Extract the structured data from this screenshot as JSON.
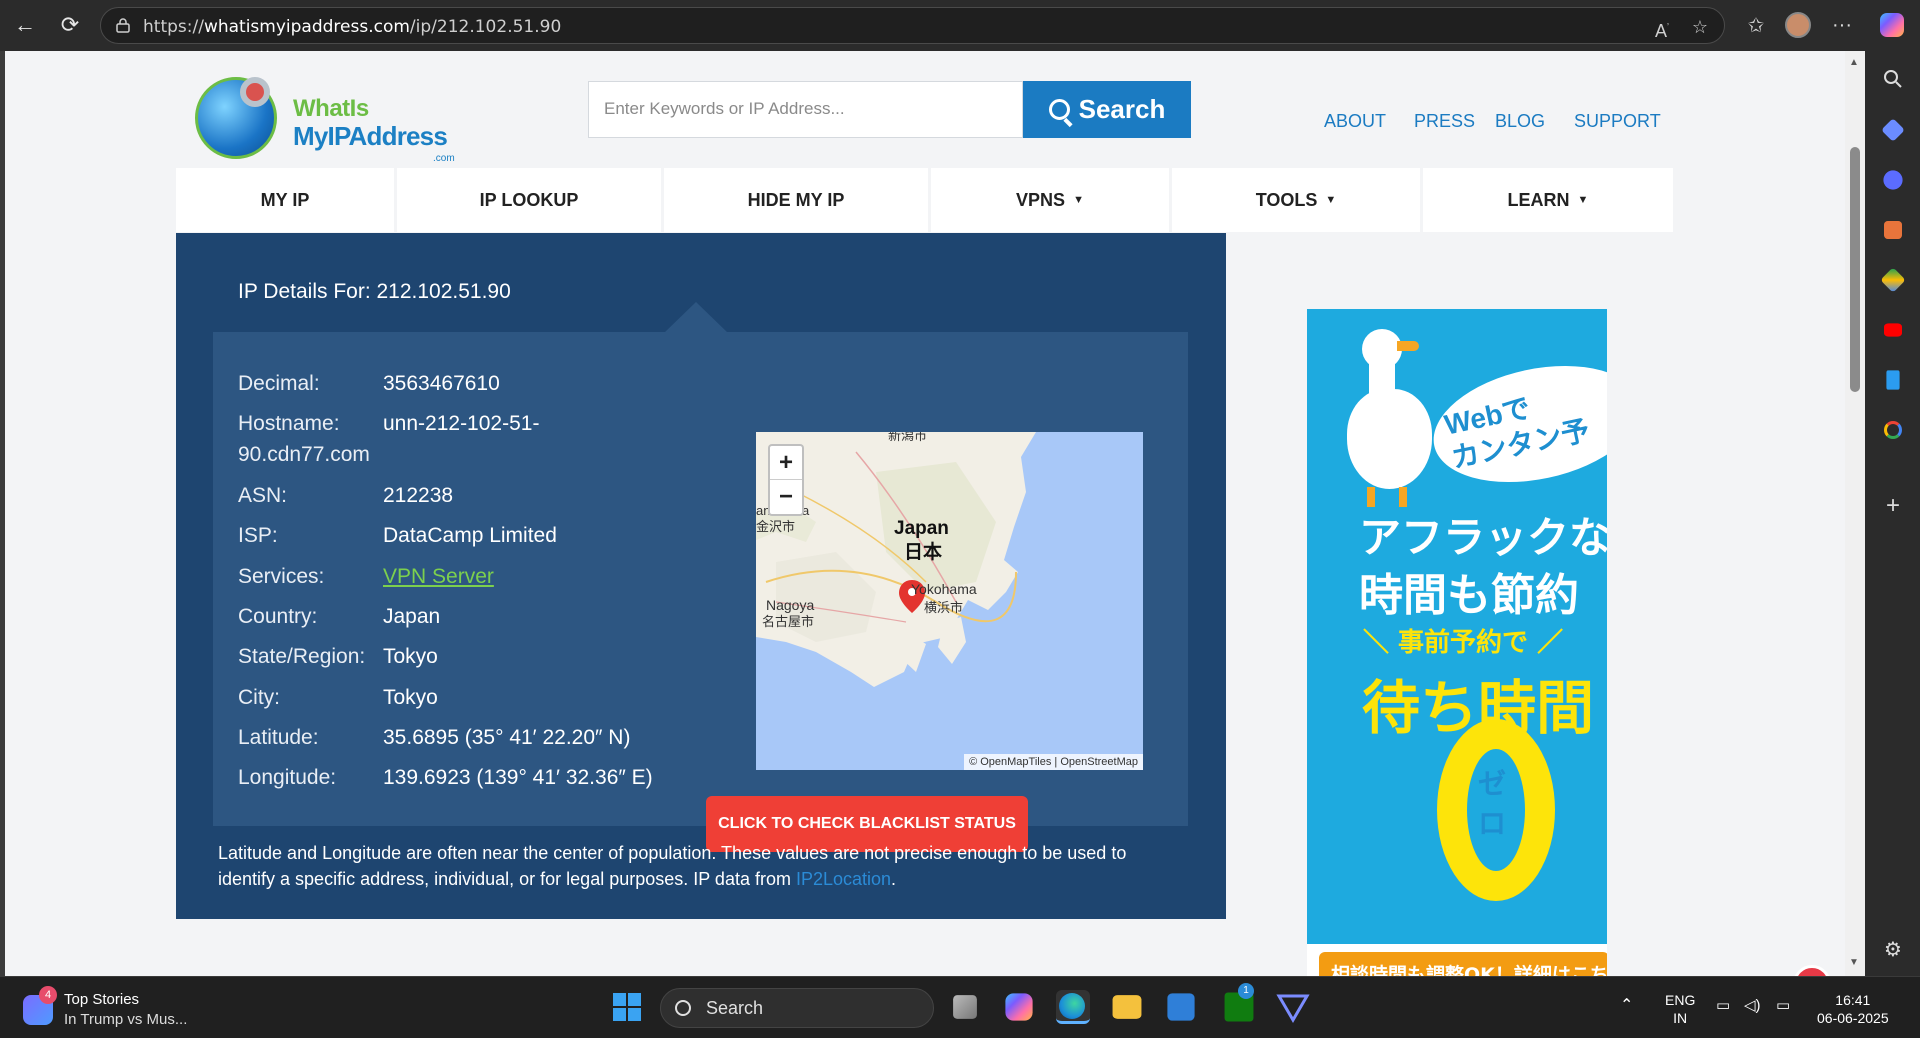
{
  "browser": {
    "url_prefix": "https://",
    "url_domain": "whatismyipaddress.com",
    "url_path": "/ip/212.102.51.90"
  },
  "site": {
    "logo_line1": "WhatIs",
    "logo_line2": "MyIPAddress",
    "logo_line3": ".com",
    "search_placeholder": "Enter Keywords or IP Address...",
    "search_button": "Search",
    "top_links": [
      "ABOUT",
      "PRESS",
      "BLOG",
      "SUPPORT"
    ]
  },
  "nav": [
    {
      "label": "MY IP",
      "dropdown": false
    },
    {
      "label": "IP LOOKUP",
      "dropdown": false
    },
    {
      "label": "HIDE MY IP",
      "dropdown": false
    },
    {
      "label": "VPNS",
      "dropdown": true
    },
    {
      "label": "TOOLS",
      "dropdown": true
    },
    {
      "label": "LEARN",
      "dropdown": true
    }
  ],
  "details": {
    "heading": "IP Details For: 212.102.51.90",
    "rows": [
      {
        "label": "Decimal:",
        "value": "3563467610"
      },
      {
        "label": "Hostname:",
        "value": "unn-212-102-51-",
        "value2": "90.cdn77.com"
      },
      {
        "label": "ASN:",
        "value": "212238"
      },
      {
        "label": "ISP:",
        "value": "DataCamp Limited"
      },
      {
        "label": "Services:",
        "value": "VPN Server",
        "link": true
      },
      {
        "label": "Country:",
        "value": "Japan"
      },
      {
        "label": "State/Region:",
        "value": "Tokyo"
      },
      {
        "label": "City:",
        "value": "Tokyo"
      },
      {
        "label": "Latitude:",
        "value": "35.6895 (35° 41′ 22.20″ N)"
      },
      {
        "label": "Longitude:",
        "value": "139.6923 (139° 41′ 32.36″ E)"
      }
    ],
    "blacklist_button": "CLICK TO CHECK BLACKLIST STATUS",
    "disclaimer": "Latitude and Longitude are often near the center of population. These values are not precise enough to be used to identify a specific address, individual, or for legal purposes. IP data from ",
    "disclaimer_link": "IP2Location",
    "disclaimer_end": "."
  },
  "map": {
    "zoom_in": "+",
    "zoom_out": "−",
    "label_country_en": "Japan",
    "label_country_ja": "日本",
    "label_city1_en": "Nagoya",
    "label_city1_ja": "名古屋市",
    "label_city2_en": "Yokohama",
    "label_city2_ja": "横浜市",
    "label_city3_ja": "金沢市",
    "label_city4_ja": "新潟市",
    "label_city3_en_partial": "an",
    "label_city3_en_partial_b": "a",
    "attribution": "© OpenMapTiles | OpenStreetMap"
  },
  "ad": {
    "bubble_line1": "Webで",
    "bubble_line2": "カンタン予",
    "line1": "アフラックなら",
    "line2": "時間も節約",
    "line3": "＼ 事前予約で ／",
    "line4": "待ち時間",
    "zero_text": "ゼロ",
    "footer": "相談時間も調整OK！詳細はこち"
  },
  "taskbar": {
    "news_title": "Top Stories",
    "news_sub": "In Trump vs Mus...",
    "news_badge": "4",
    "search": "Search",
    "xbox_badge": "1",
    "lang1": "ENG",
    "lang2": "IN",
    "time": "16:41",
    "date": "06-06-2025"
  },
  "colors": {
    "brand_blue": "#1b7bc2",
    "panel_dark": "#1e4570",
    "panel_inner": "#2d5682",
    "danger": "#ef3f36",
    "link_green": "#7cd04d"
  }
}
